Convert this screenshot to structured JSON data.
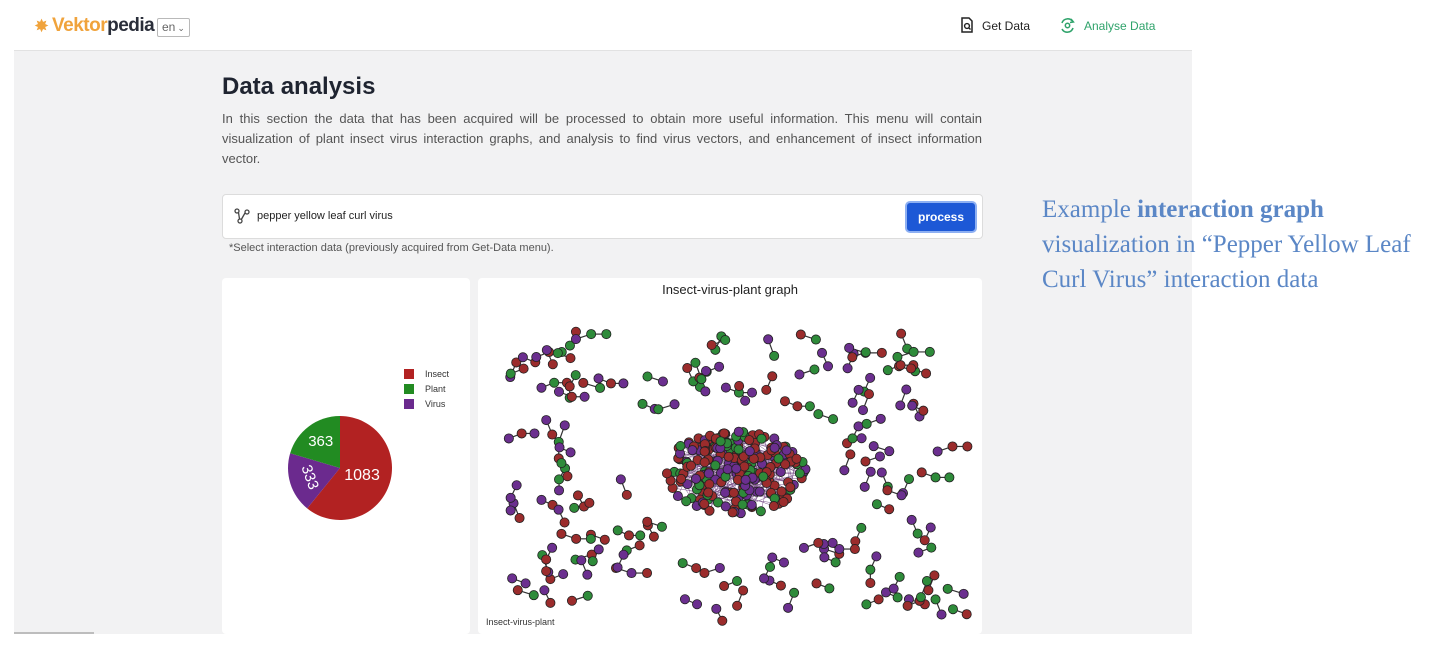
{
  "app": {
    "logo": {
      "part1": "Vektor",
      "part2": "pedia"
    },
    "language": "en"
  },
  "nav": {
    "get_data": "Get Data",
    "analyse_data": "Analyse Data"
  },
  "main": {
    "title": "Data analysis",
    "description": "In this section the data that has been acquired will be processed to obtain more useful information. This menu will contain visualization of plant insect virus interaction graphs, and analysis to find virus vectors, and enhancement of insect information vector.",
    "search": {
      "value": "pepper yellow leaf curl virus",
      "button": "process"
    },
    "hint": "*Select interaction data (previously acquired from Get-Data menu)."
  },
  "pie_chart": {
    "type": "pie",
    "legend": [
      "Insect",
      "Plant",
      "Virus"
    ],
    "values": {
      "Insect": 1083,
      "Plant": 363,
      "Virus": 333
    },
    "labels": {
      "insect": "1083",
      "plant": "363",
      "virus": "333"
    },
    "colors": {
      "Insect": "#b22222",
      "Plant": "#228b22",
      "Virus": "#6b2a8e"
    }
  },
  "graph": {
    "title": "Insect-virus-plant graph",
    "caption": "Insect-virus-plant",
    "colors": {
      "insect": "#9b2c2c",
      "plant": "#2e8b3a",
      "virus": "#6b2f8f"
    }
  },
  "annotation": {
    "part1": "Example ",
    "bold": "interaction graph",
    "part2": " visualization in “Pepper Yellow Leaf Curl Virus” interaction data"
  }
}
